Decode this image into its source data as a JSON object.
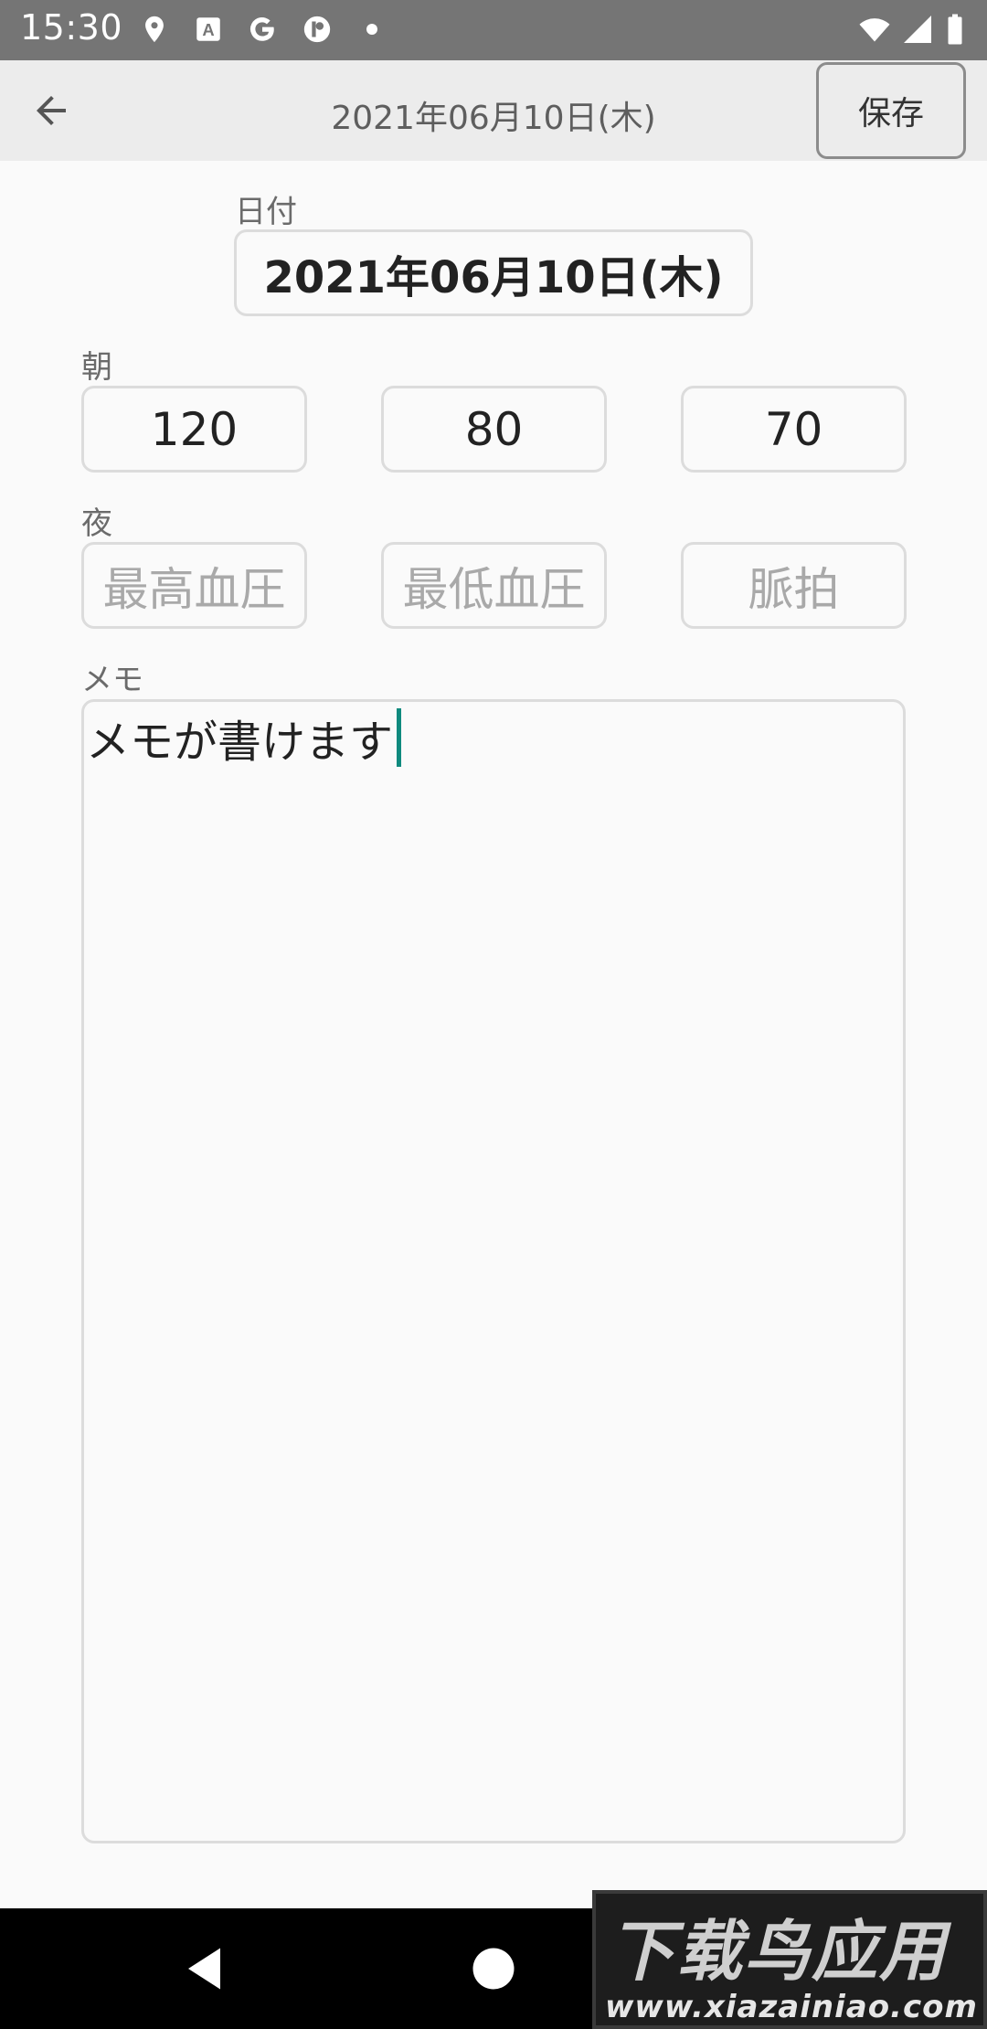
{
  "status_bar": {
    "time": "15:30",
    "left_icons": [
      "location-icon",
      "app-a-icon",
      "google-icon",
      "app-p-icon",
      "dot-icon"
    ],
    "right_icons": [
      "wifi-icon",
      "signal-icon",
      "battery-icon"
    ]
  },
  "app_bar": {
    "title": "2021年06月10日(木)",
    "save_label": "保存",
    "back_icon": "arrow-back-icon"
  },
  "form": {
    "date_label": "日付",
    "date_value": "2021年06月10日(木)",
    "morning_label": "朝",
    "morning": {
      "systolic": "120",
      "diastolic": "80",
      "pulse": "70"
    },
    "night_label": "夜",
    "night": {
      "systolic_placeholder": "最高血圧",
      "diastolic_placeholder": "最低血圧",
      "pulse_placeholder": "脈拍"
    },
    "memo_label": "メモ",
    "memo_value": "メモが書けます"
  },
  "nav_bar": {
    "icons": [
      "back-triangle-icon",
      "home-circle-icon",
      "recents-square-icon"
    ]
  },
  "watermark": {
    "title": "下载鸟应用",
    "url": "www.xiazainiao.com"
  },
  "colors": {
    "status_bar": "#757575",
    "app_bar": "#ececec",
    "caret": "#0f8a7e",
    "nav_bar": "#000000"
  }
}
